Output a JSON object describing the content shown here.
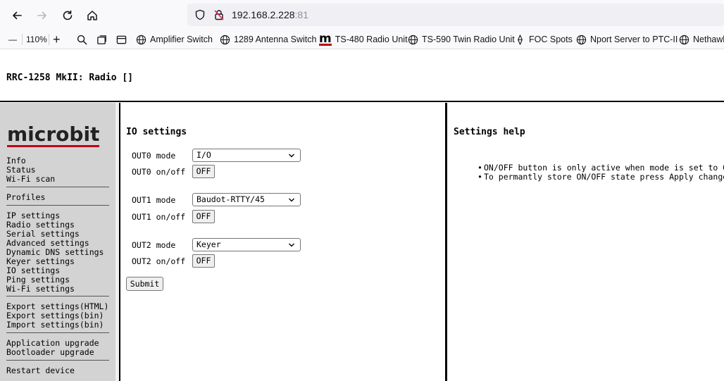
{
  "browser": {
    "url_host": "192.168.2.228",
    "url_port": ":81",
    "zoom_minus": "—",
    "zoom_level": "110%",
    "zoom_plus": "+",
    "bookmarks": [
      {
        "label": "Amplifier Switch",
        "icon": "globe-icon"
      },
      {
        "label": "1289 Antenna Switch",
        "icon": "globe-icon"
      },
      {
        "label": "TS-480 Radio Unit",
        "icon": "microbit-logo-icon"
      },
      {
        "label": "TS-590 Twin Radio Unit",
        "icon": "globe-icon"
      },
      {
        "label": "FOC Spots",
        "icon": "diamond-icon"
      },
      {
        "label": "Nport Server to PTC-II",
        "icon": "globe-icon"
      },
      {
        "label": "Nethawk",
        "icon": "globe-icon"
      }
    ],
    "bookmark_logo_text": "m"
  },
  "page": {
    "title": "RRC-1258 MkII: Radio []"
  },
  "sidebar": {
    "logo": "microbit",
    "groups": [
      [
        "Info",
        "Status",
        "Wi-Fi scan"
      ],
      [
        "Profiles"
      ],
      [
        "IP settings",
        "Radio settings",
        "Serial settings",
        "Advanced settings",
        "Dynamic DNS settings",
        "Keyer settings",
        "IO settings",
        "Ping settings",
        "Wi-Fi settings"
      ],
      [
        "Export settings(HTML)",
        "Export settings(bin)",
        "Import settings(bin)"
      ],
      [
        "Application upgrade",
        "Bootloader upgrade"
      ],
      [
        "Restart device"
      ]
    ]
  },
  "io_settings": {
    "title": "IO settings",
    "outputs": [
      {
        "mode_label": "OUT0 mode",
        "mode_value": "I/O",
        "onoff_label": "OUT0 on/off",
        "onoff_value": "OFF"
      },
      {
        "mode_label": "OUT1 mode",
        "mode_value": "Baudot-RTTY/45",
        "onoff_label": "OUT1 on/off",
        "onoff_value": "OFF"
      },
      {
        "mode_label": "OUT2 mode",
        "mode_value": "Keyer",
        "onoff_label": "OUT2 on/off",
        "onoff_value": "OFF"
      }
    ],
    "submit_label": "Submit"
  },
  "help": {
    "title": "Settings help",
    "items": [
      "ON/OFF button is only active when mode is set to On/Off",
      "To permantly store ON/OFF state press Apply changes"
    ]
  },
  "colors": {
    "sidebar_bg": "#d3d3d3",
    "logo_underline": "#c0001a",
    "chrome_bg": "#f9f9fb"
  }
}
